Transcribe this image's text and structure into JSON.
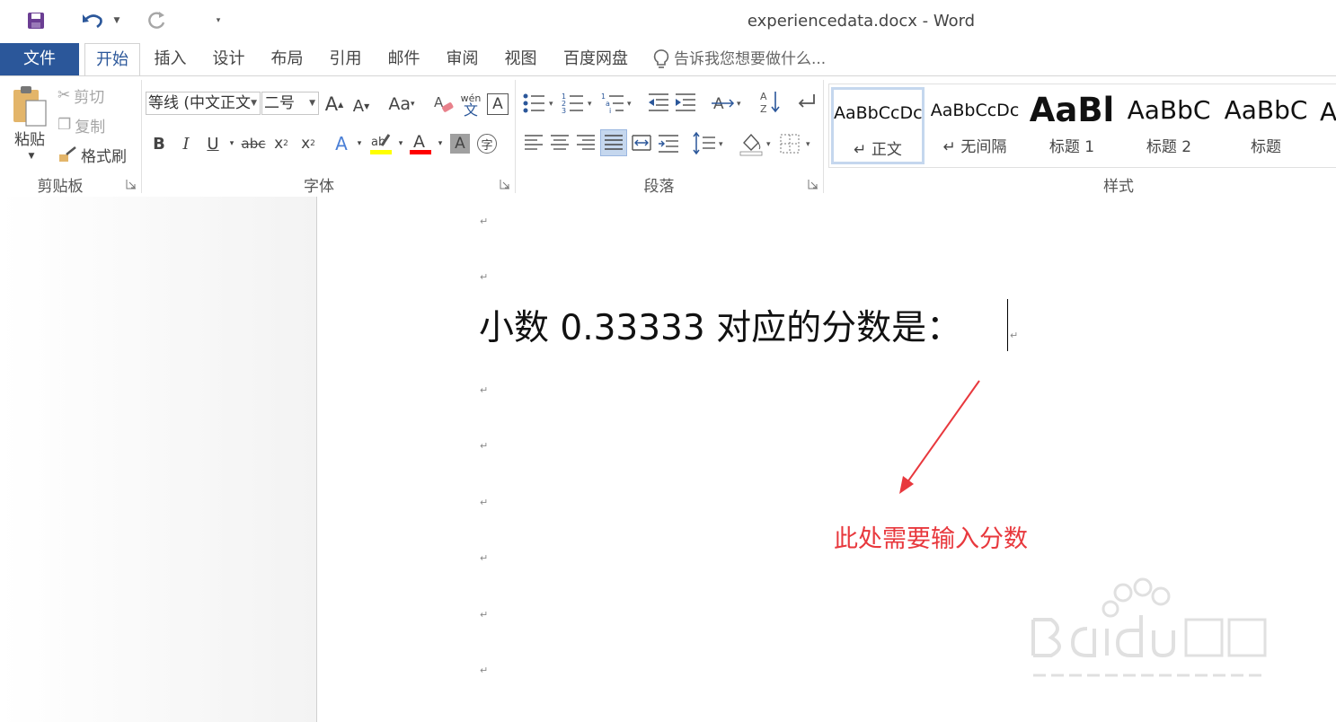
{
  "window": {
    "title": "experiencedata.docx - Word"
  },
  "tabs": {
    "file": "文件",
    "home": "开始",
    "items": [
      "插入",
      "设计",
      "布局",
      "引用",
      "邮件",
      "审阅",
      "视图",
      "百度网盘"
    ],
    "tell_me": "告诉我您想要做什么..."
  },
  "clipboard": {
    "paste": "粘贴",
    "cut": "剪切",
    "copy": "复制",
    "format_painter": "格式刷",
    "label": "剪贴板"
  },
  "font": {
    "name": "等线 (中文正文",
    "size": "二号",
    "label": "字体",
    "change_case": "Aa",
    "bold": "B",
    "italic": "I",
    "underline": "U",
    "strike": "abc",
    "subscript": "x",
    "superscript": "x",
    "phonetic_top": "wén",
    "phonetic_bottom": "文",
    "border_char": "A",
    "enclose_char": "字"
  },
  "paragraph": {
    "label": "段落"
  },
  "styles": {
    "label": "样式",
    "items": [
      {
        "sample": "AaBbCcDc",
        "name": "↵ 正文"
      },
      {
        "sample": "AaBbCcDc",
        "name": "↵ 无间隔"
      },
      {
        "sample": "AaBl",
        "name": "标题 1"
      },
      {
        "sample": "AaBbC",
        "name": "标题 2"
      },
      {
        "sample": "AaBbC",
        "name": "标题"
      }
    ]
  },
  "document": {
    "line": "小数  0.33333  对应的分数是：",
    "paragraph_mark": "↵",
    "annotation": "此处需要输入分数"
  },
  "colors": {
    "file_tab": "#2b579a",
    "annotation": "#e8383d",
    "highlight": "#ffff00",
    "font_color": "#ff0000"
  }
}
